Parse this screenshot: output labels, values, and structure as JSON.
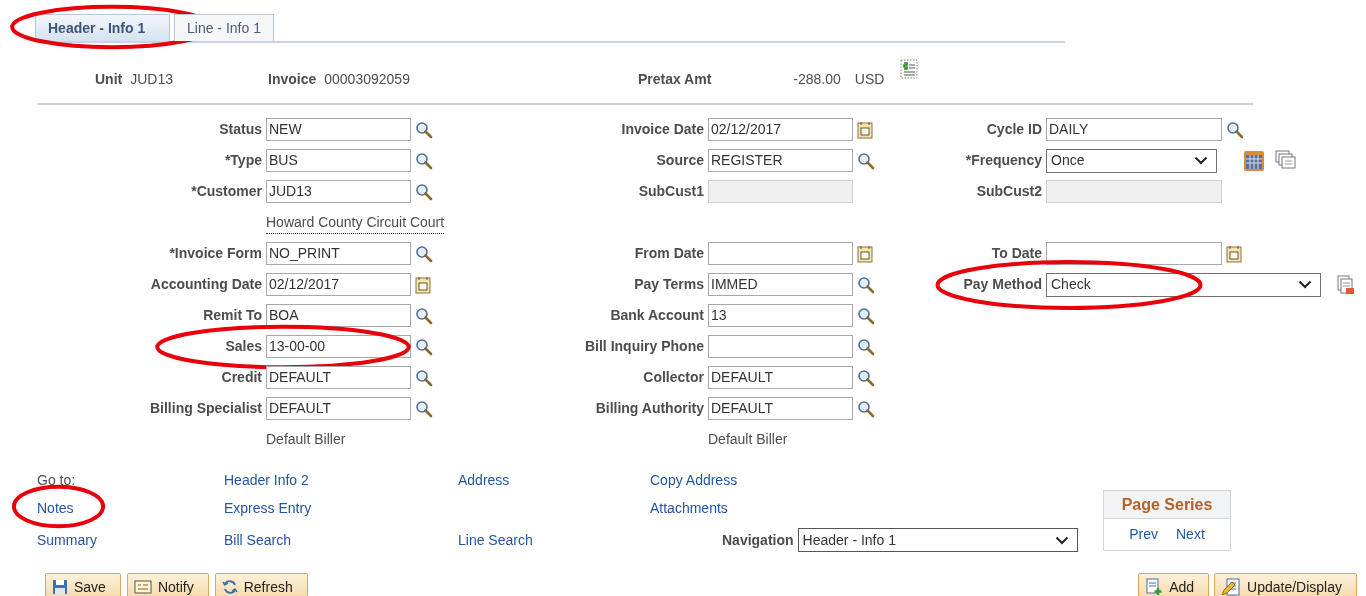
{
  "tabs": [
    {
      "label": "Header - Info 1",
      "selected": true,
      "circled": true
    },
    {
      "label": "Line - Info 1",
      "selected": false,
      "circled": false
    }
  ],
  "header": {
    "unit_label": "Unit",
    "unit": "JUD13",
    "invoice_label": "Invoice",
    "invoice": "00003092059",
    "pretax_label": "Pretax Amt",
    "pretax_amount": "-288.00",
    "currency": "USD"
  },
  "rows": [
    {
      "left": {
        "kind": "lookup",
        "label": "Status",
        "value": "NEW"
      },
      "middle": {
        "kind": "date",
        "label": "Invoice Date",
        "value": "02/12/2017"
      },
      "right": {
        "kind": "lookup",
        "label": "Cycle ID",
        "value": "DAILY"
      }
    },
    {
      "left": {
        "kind": "lookup",
        "label": "*Type",
        "value": "BUS"
      },
      "middle": {
        "kind": "lookup",
        "label": "Source",
        "value": "REGISTER"
      },
      "right": {
        "kind": "select",
        "label": "*Frequency",
        "value": "Once"
      }
    },
    {
      "left": {
        "kind": "lookup",
        "label": "*Customer",
        "value": "JUD13"
      },
      "middle": {
        "kind": "disabled",
        "label": "SubCust1"
      },
      "right": {
        "kind": "disabled",
        "label": "SubCust2"
      }
    },
    {
      "left": {
        "kind": "description",
        "text": "Howard County Circuit Court"
      }
    },
    {
      "left": {
        "kind": "lookup",
        "label": "*Invoice Form",
        "value": "NO_PRINT"
      },
      "middle": {
        "kind": "date",
        "label": "From Date"
      },
      "right": {
        "kind": "date",
        "label": "To Date"
      }
    },
    {
      "left": {
        "kind": "date",
        "label": "Accounting Date",
        "value": "02/12/2017"
      },
      "middle": {
        "kind": "lookup",
        "label": "Pay Terms",
        "value": "IMMED"
      },
      "right": {
        "kind": "wide_select",
        "label": "Pay Method",
        "value": "Check",
        "circled": true
      }
    },
    {
      "left": {
        "kind": "lookup",
        "label": "Remit To",
        "value": "BOA"
      },
      "middle": {
        "kind": "lookup",
        "label": "Bank Account",
        "value": "13"
      }
    },
    {
      "left": {
        "kind": "lookup",
        "label": "Sales",
        "value": "13-00-00",
        "circled": true
      },
      "middle": {
        "kind": "lookup",
        "label": "Bill Inquiry Phone"
      }
    },
    {
      "left": {
        "kind": "lookup",
        "label": "Credit",
        "value": "DEFAULT"
      },
      "middle": {
        "kind": "lookup",
        "label": "Collector",
        "value": "DEFAULT"
      }
    },
    {
      "left": {
        "kind": "lookup",
        "label": "Billing Specialist",
        "value": "DEFAULT"
      },
      "middle": {
        "kind": "lookup",
        "label": "Billing Authority",
        "value": "DEFAULT"
      }
    },
    {
      "left": {
        "kind": "note",
        "text": "Default Biller"
      },
      "middle": {
        "kind": "note",
        "text": "Default Biller"
      }
    }
  ],
  "goto_rows": [
    {
      "col_1": {
        "kind": "caption",
        "text": "Go to:"
      },
      "col_2": {
        "kind": "link",
        "text": "Header Info 2",
        "circled": false
      },
      "col_3": {
        "kind": "link",
        "text": "Address",
        "circled": false
      },
      "col_4": {
        "kind": "link",
        "text": "Copy Address",
        "circled": false
      }
    },
    {
      "col_1": {
        "kind": "link",
        "text": "Notes",
        "circled": true
      },
      "col_2": {
        "kind": "link",
        "text": "Express Entry",
        "circled": false
      },
      "col_4": {
        "kind": "link",
        "text": "Attachments",
        "circled": false
      }
    },
    {
      "col_1": {
        "kind": "link",
        "text": "Summary",
        "circled": false
      },
      "col_2": {
        "kind": "link",
        "text": "Bill Search",
        "circled": false
      },
      "col_3": {
        "kind": "link",
        "text": "Line Search",
        "circled": false
      },
      "col_4": {
        "kind": "navigation",
        "label": "Navigation",
        "value": "Header - Info 1"
      }
    }
  ],
  "page_series": {
    "title": "Page Series",
    "prev": "Prev",
    "next": "Next"
  },
  "left_buttons": [
    {
      "label": "Save"
    },
    {
      "label": "Notify"
    },
    {
      "label": "Refresh"
    }
  ],
  "right_buttons": [
    {
      "label": "Add"
    },
    {
      "label": "Update/Display"
    }
  ]
}
